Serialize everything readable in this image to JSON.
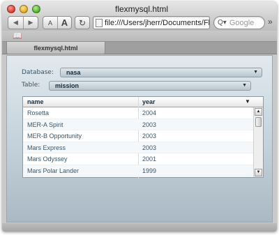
{
  "window": {
    "title": "flexmysql.html"
  },
  "toolbar": {
    "back_icon": "back-arrow-icon",
    "forward_icon": "forward-arrow-icon",
    "text_smaller_label": "A",
    "text_bigger_label": "A",
    "reload_icon": "reload-icon",
    "address": "file:///Users/jherr/Documents/Fl",
    "search_placeholder": "Google",
    "search_icon": "Q▾",
    "overflow_icon": "»"
  },
  "bookmarks": {
    "icon": "book-icon"
  },
  "tabs": [
    {
      "label": "flexmysql.html"
    }
  ],
  "form": {
    "database_label": "Database:",
    "database_value": "nasa",
    "table_label": "Table:",
    "table_value": "mission"
  },
  "grid": {
    "columns": [
      "name",
      "year"
    ],
    "sort_indicator": "▼",
    "rows": [
      {
        "name": "Rosetta",
        "year": "2004"
      },
      {
        "name": "MER-A Spirit",
        "year": "2003"
      },
      {
        "name": "MER-B Opportunity",
        "year": "2003"
      },
      {
        "name": "Mars Express",
        "year": "2003"
      },
      {
        "name": "Mars Odyssey",
        "year": "2001"
      },
      {
        "name": "Mars Polar Lander",
        "year": "1999"
      }
    ]
  },
  "colors": {
    "content_top": "#e1e9ee",
    "content_bottom": "#aab9c3",
    "label_text": "#35536a"
  }
}
